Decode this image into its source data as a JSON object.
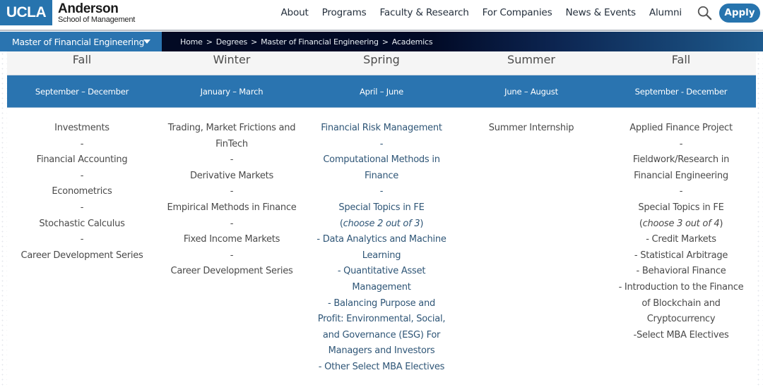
{
  "header": {
    "logo": {
      "mark": "UCLA",
      "name": "Anderson",
      "subtitle": "School of Management"
    },
    "nav": [
      "About",
      "Programs",
      "Faculty & Research",
      "For Companies",
      "News & Events",
      "Alumni"
    ],
    "search_icon": "search-icon",
    "apply_label": "Apply"
  },
  "subbar": {
    "program": "Master of Financial Engineering",
    "breadcrumb": [
      "Home",
      "Degrees",
      "Master of Financial Engineering",
      "Academics"
    ],
    "separator": ">"
  },
  "colors": {
    "brand_blue": "#2774ae",
    "nav_blue": "#2a74b0",
    "breadcrumb_dark": "#020a24",
    "course_link": "#2f5677"
  },
  "schedule": {
    "terms": [
      {
        "season": "Fall",
        "months": "September – December",
        "courses": [
          "Investments",
          "-",
          "Financial Accounting",
          "-",
          "Econometrics",
          "-",
          "Stochastic Calculus",
          "-",
          "Career Development Series"
        ]
      },
      {
        "season": "Winter",
        "months": "January – March",
        "courses": [
          "Trading, Market Frictions and FinTech",
          "-",
          "Derivative Markets",
          "-",
          "Empirical Methods in Finance",
          "-",
          "Fixed Income Markets",
          "-",
          "Career Development Series"
        ]
      },
      {
        "season": "Spring",
        "months": "April – June",
        "courses": [
          "Financial Risk Management",
          "-",
          "Computational Methods in Finance",
          "-",
          "Special Topics in FE",
          "(choose 2 out of 3)",
          "- Data Analytics and Machine Learning",
          "- Quantitative Asset Management",
          "- Balancing Purpose and Profit: Environmental, Social, and Governance (ESG) For Managers and Investors",
          "- Other Select MBA Electives"
        ]
      },
      {
        "season": "Summer",
        "months": "June – August",
        "courses": [
          "Summer Internship"
        ]
      },
      {
        "season": "Fall",
        "months": "September - December",
        "courses": [
          "Applied Finance Project",
          "-",
          "Fieldwork/Research in Financial Engineering",
          "-",
          "Special Topics in FE",
          "(choose 3 out of 4)",
          "- Credit Markets",
          "- Statistical Arbitrage",
          "- Behavioral Finance",
          "- Introduction to the Finance of Blockchain and Cryptocurrency",
          "-Select MBA Electives"
        ]
      }
    ]
  }
}
